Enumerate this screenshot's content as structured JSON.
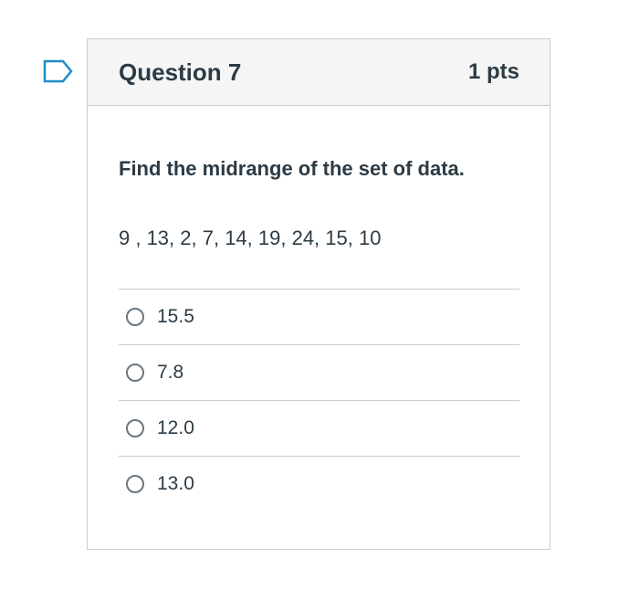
{
  "question": {
    "title": "Question 7",
    "points": "1 pts",
    "prompt": "Find the midrange of the set of data.",
    "data_values": "9 , 13, 2, 7, 14, 19, 24, 15, 10",
    "answers": [
      {
        "label": "15.5",
        "selected": false
      },
      {
        "label": "7.8",
        "selected": false
      },
      {
        "label": "12.0",
        "selected": false
      },
      {
        "label": "13.0",
        "selected": false
      }
    ]
  },
  "colors": {
    "flag": "#1c8dc6",
    "header_bg": "#f5f5f5",
    "border": "#c7cdd1",
    "text": "#2d3b45"
  },
  "icons": {
    "flag": "flag-question-icon",
    "radio": "radio-unchecked-icon"
  }
}
